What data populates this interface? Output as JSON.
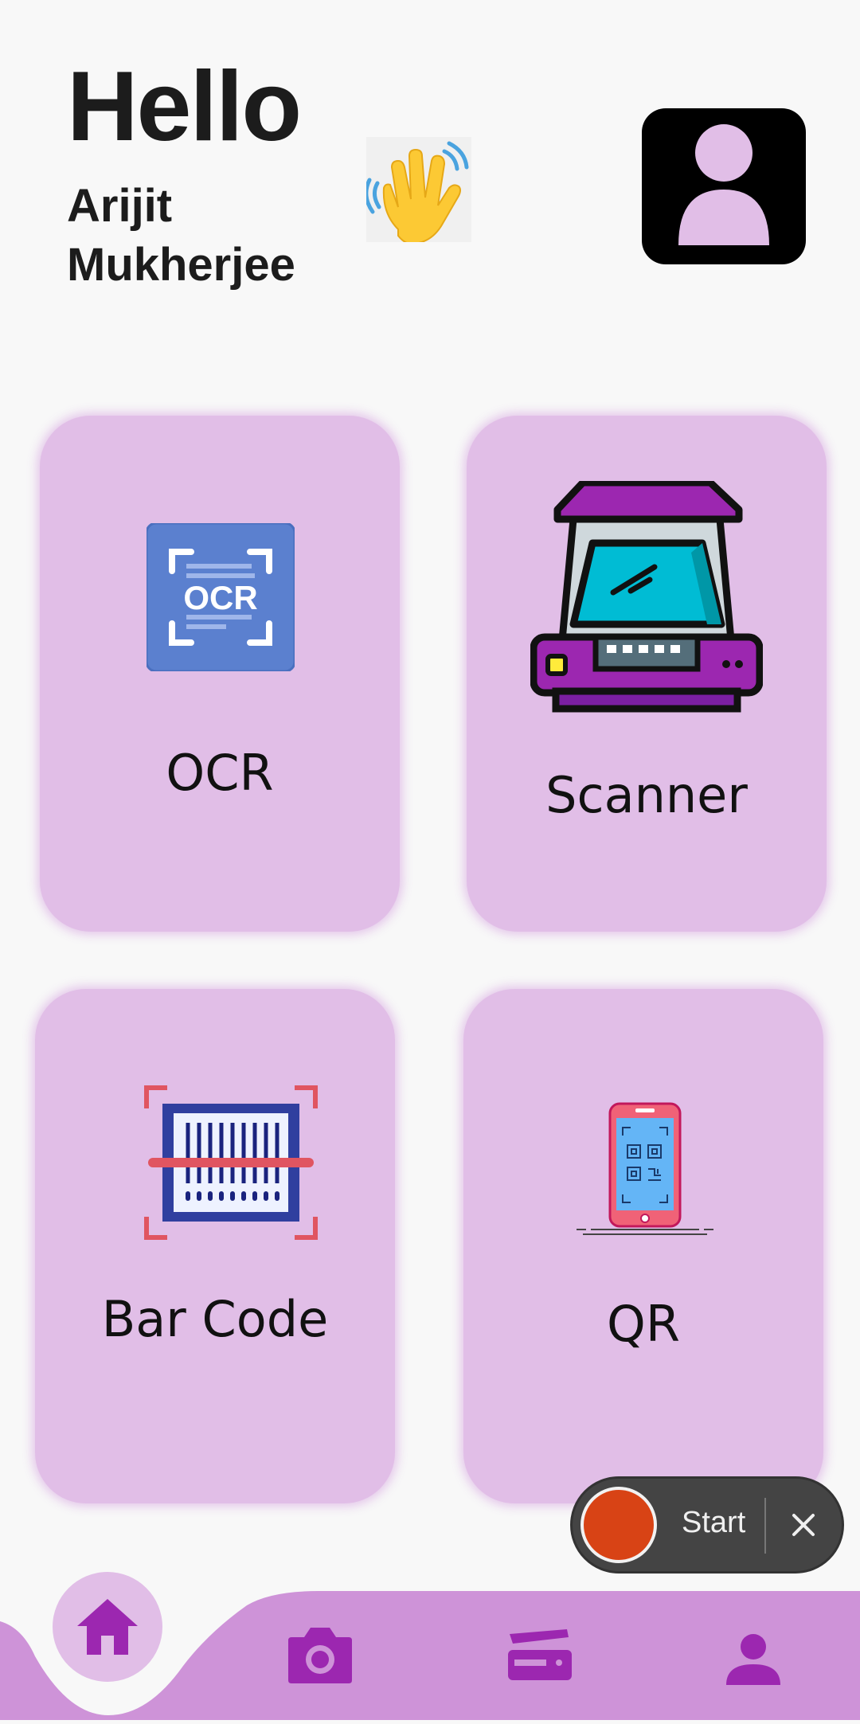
{
  "header": {
    "hello": "Hello",
    "name": "Arijit Mukherjee"
  },
  "cards": [
    {
      "label": "OCR",
      "icon": "ocr-icon",
      "icon_text": "OCR"
    },
    {
      "label": "Scanner",
      "icon": "scanner-icon"
    },
    {
      "label": "Bar Code",
      "icon": "barcode-icon"
    },
    {
      "label": "QR",
      "icon": "qr-phone-icon"
    }
  ],
  "recorder": {
    "start_label": "Start"
  },
  "bottom_nav": [
    {
      "icon": "home-icon",
      "selected": true
    },
    {
      "icon": "camera-icon"
    },
    {
      "icon": "scanner-icon"
    },
    {
      "icon": "person-icon"
    }
  ],
  "colors": {
    "card_bg": "#e1bee7",
    "nav_bg": "#ce93d8",
    "accent": "#9c27b0",
    "record": "#d84315"
  }
}
